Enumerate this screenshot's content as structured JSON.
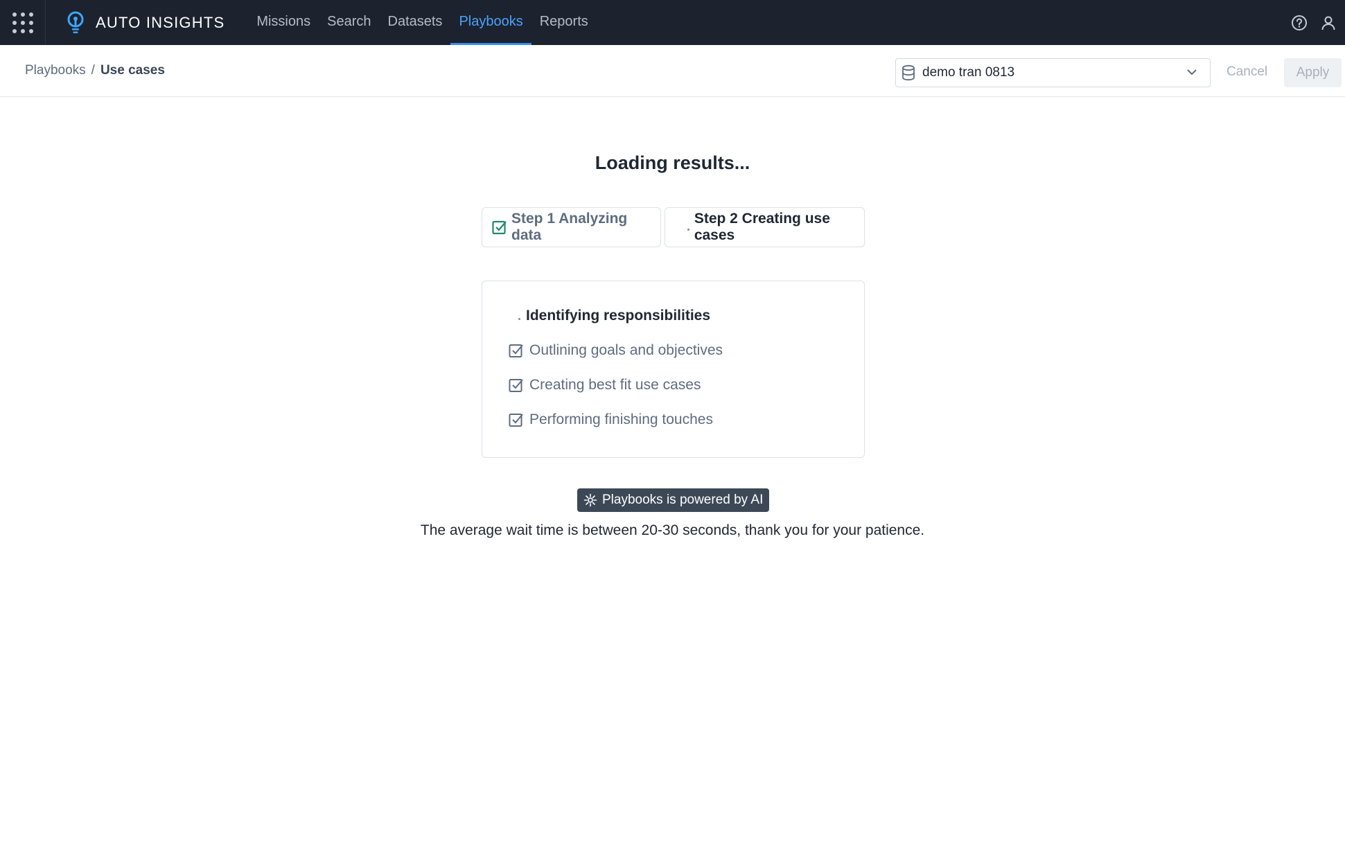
{
  "app": {
    "brand": "AUTO INSIGHTS"
  },
  "nav": {
    "items": [
      {
        "label": "Missions"
      },
      {
        "label": "Search"
      },
      {
        "label": "Datasets"
      },
      {
        "label": "Playbooks",
        "active": true
      },
      {
        "label": "Reports"
      }
    ],
    "icons": [
      "apps-grid-icon",
      "lightbulb-logo-icon",
      "help-icon",
      "user-icon"
    ]
  },
  "breadcrumb": {
    "parent": "Playbooks",
    "separator": "/",
    "current": "Use cases"
  },
  "dataset_select": {
    "value": "demo tran 0813",
    "icon": "database-icon"
  },
  "actions": {
    "cancel": "Cancel",
    "apply": "Apply"
  },
  "loading": {
    "title": "Loading results...",
    "steps": [
      {
        "label": "Step 1 Analyzing data",
        "status": "done"
      },
      {
        "label": "Step 2 Creating use cases",
        "status": "in-progress"
      }
    ],
    "tasks": [
      {
        "label": "Identifying responsibilities",
        "status": "in-progress"
      },
      {
        "label": "Outlining goals and objectives",
        "status": "pending"
      },
      {
        "label": "Creating best fit use cases",
        "status": "pending"
      },
      {
        "label": "Performing finishing touches",
        "status": "pending"
      }
    ]
  },
  "footer": {
    "badge": "Playbooks is powered by AI",
    "wait_text": "The average wait time is between 20-30 seconds, thank you for your patience."
  },
  "colors": {
    "topbar": "#1c232e",
    "accent": "#4aa3ff",
    "success": "#1e8a6e",
    "badge": "#3d4856"
  }
}
